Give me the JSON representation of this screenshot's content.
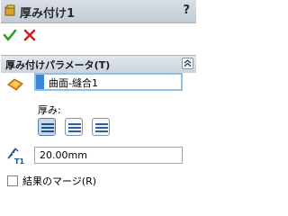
{
  "title": "厚み付け1",
  "help_symbol": "?",
  "group": {
    "title": "厚み付けパラメータ(T)",
    "selection": "曲面-縫合1",
    "thickness_label": "厚み:",
    "thickness_options": [
      "side-1",
      "both-sides",
      "side-2"
    ],
    "thickness_selected": "side-1",
    "thickness_value": "20.00mm",
    "thickness_icon_label": "T1",
    "merge_label": "結果のマージ(R)",
    "merge_checked": false
  },
  "colors": {
    "ok": "#2e9b2e",
    "cancel": "#d32020",
    "selection_border": "#8ec0e8",
    "selection_marker": "#3a86d4"
  }
}
